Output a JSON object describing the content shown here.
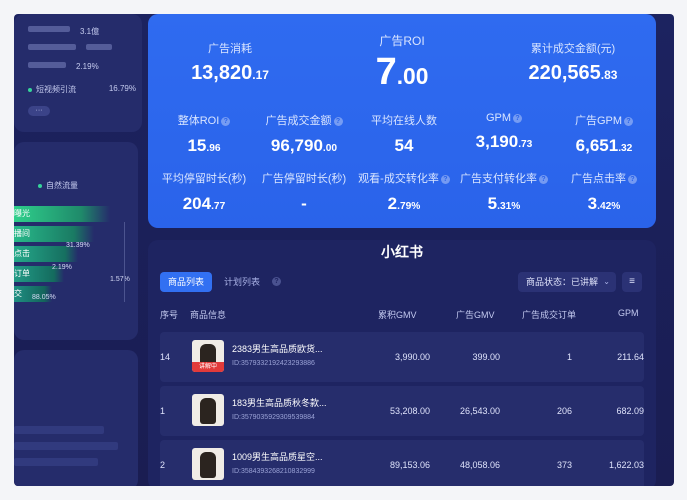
{
  "left_panel_top": {
    "rows": [
      {
        "value": "3.1億"
      },
      {
        "value": "2.19%"
      },
      {
        "value": "16.79%",
        "label": "短视频引流"
      }
    ],
    "more_label": "···"
  },
  "funnel": {
    "legend": "自然流量",
    "stages": [
      "曝光",
      "播间",
      "点击",
      "订单",
      "交"
    ],
    "percents": [
      "31.39%",
      "2.19%",
      "1.57%",
      "88.05%"
    ]
  },
  "headline": {
    "ad_spend": {
      "label": "广告消耗",
      "int": "13,820",
      "dec": ".17"
    },
    "ad_roi": {
      "label": "广告ROI",
      "int": "7",
      "dec": ".00"
    },
    "cum_gmv": {
      "label": "累计成交金额(元)",
      "int": "220,565",
      "dec": ".83"
    }
  },
  "metrics_row1": [
    {
      "label": "整体ROI",
      "int": "15",
      "dec": ".96",
      "help": "?"
    },
    {
      "label": "广告成交金额",
      "int": "96,790",
      "dec": ".00",
      "help": "?"
    },
    {
      "label": "平均在线人数",
      "int": "54",
      "dec": "",
      "help": ""
    },
    {
      "label": "GPM",
      "int": "3,190",
      "dec": ".73",
      "help": "?"
    },
    {
      "label": "广告GPM",
      "int": "6,651",
      "dec": ".32",
      "help": "?"
    }
  ],
  "metrics_row2": [
    {
      "label": "平均停留时长(秒)",
      "int": "204",
      "dec": ".77",
      "help": ""
    },
    {
      "label": "广告停留时长(秒)",
      "int": "-",
      "dec": "",
      "help": ""
    },
    {
      "label": "观看-成交转化率",
      "int": "2",
      "dec": ".79%",
      "help": "?"
    },
    {
      "label": "广告支付转化率",
      "int": "5",
      "dec": ".31%",
      "help": "?"
    },
    {
      "label": "广告点击率",
      "int": "3",
      "dec": ".42%",
      "help": "?"
    }
  ],
  "table_card": {
    "brand": "小红书",
    "tabs": {
      "active": "商品列表",
      "other": "计划列表",
      "help": "?"
    },
    "status_select": "商品状态：已讲解",
    "filter_icon": "≡",
    "columns": [
      "序号",
      "商品信息",
      "累积GMV",
      "广告GMV",
      "广告成交订单",
      "GPM"
    ],
    "rows": [
      {
        "idx": "14",
        "name": "2383男生高品质欧货...",
        "id": "ID:3579332192423293886",
        "live": "讲解中",
        "gmv": "3,990.00",
        "ad_gmv": "399.00",
        "orders": "1",
        "gpm": "211.64"
      },
      {
        "idx": "1",
        "name": "183男生高品质秋冬款...",
        "id": "ID:3579035929309539884",
        "live": "",
        "gmv": "53,208.00",
        "ad_gmv": "26,543.00",
        "orders": "206",
        "gpm": "682.09"
      },
      {
        "idx": "2",
        "name": "1009男生高品质星空...",
        "id": "ID:3584393268210832999",
        "live": "",
        "gmv": "89,153.06",
        "ad_gmv": "48,058.06",
        "orders": "373",
        "gpm": "1,622.03"
      }
    ]
  }
}
